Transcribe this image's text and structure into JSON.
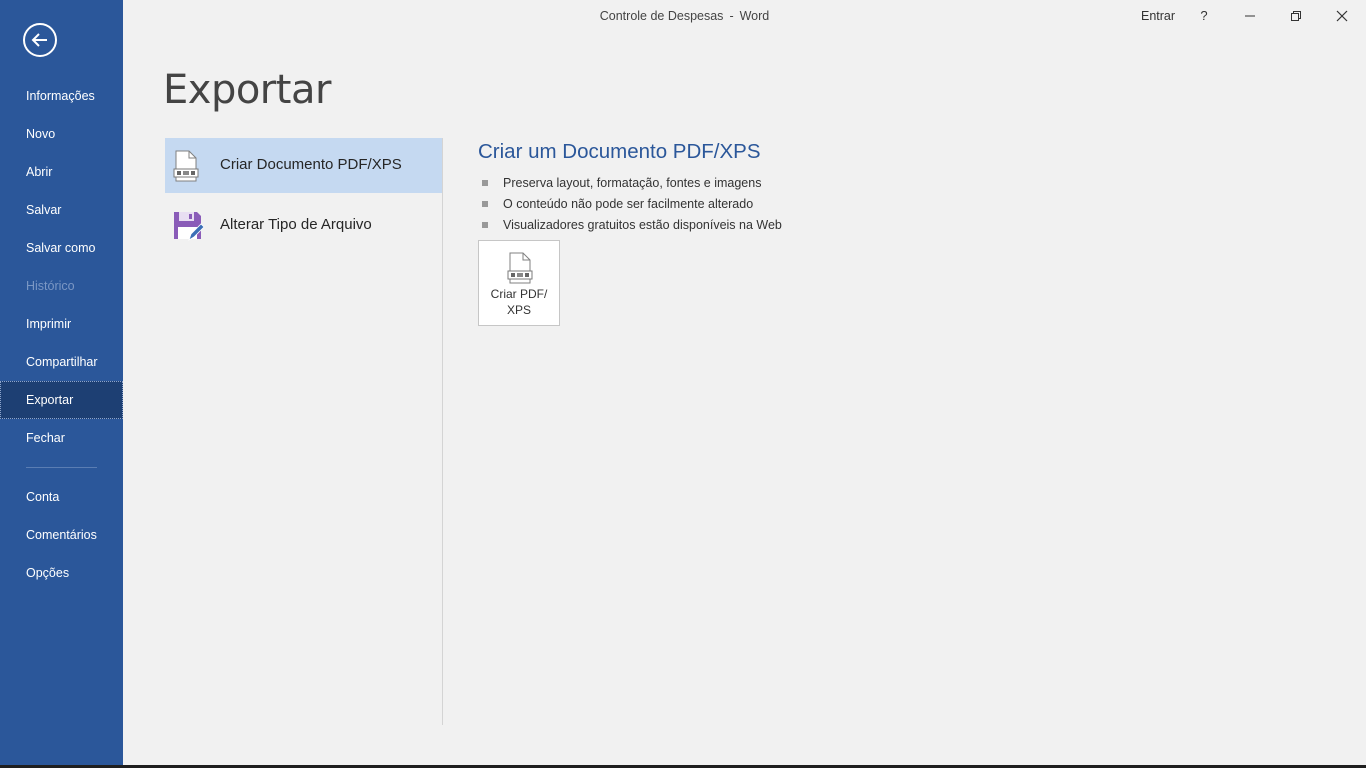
{
  "window": {
    "doc_name": "Controle de Despesas",
    "separator": "-",
    "app_name": "Word",
    "signin_label": "Entrar",
    "help_label": "?"
  },
  "sidebar": {
    "back_icon": "back-arrow-icon",
    "items": [
      {
        "label": "Informações",
        "state": "normal"
      },
      {
        "label": "Novo",
        "state": "normal"
      },
      {
        "label": "Abrir",
        "state": "normal"
      },
      {
        "label": "Salvar",
        "state": "normal"
      },
      {
        "label": "Salvar como",
        "state": "normal"
      },
      {
        "label": "Histórico",
        "state": "disabled"
      },
      {
        "label": "Imprimir",
        "state": "normal"
      },
      {
        "label": "Compartilhar",
        "state": "normal"
      },
      {
        "label": "Exportar",
        "state": "active"
      },
      {
        "label": "Fechar",
        "state": "normal"
      }
    ],
    "bottom_items": [
      {
        "label": "Conta"
      },
      {
        "label": "Comentários"
      },
      {
        "label": "Opções"
      }
    ]
  },
  "main": {
    "title": "Exportar",
    "options": [
      {
        "label": "Criar Documento PDF/XPS",
        "icon": "pdf-document-icon",
        "selected": true
      },
      {
        "label": "Alterar Tipo de Arquivo",
        "icon": "save-as-floppy-icon",
        "selected": false
      }
    ],
    "detail": {
      "title": "Criar um Documento PDF/XPS",
      "bullets": [
        "Preserva layout, formatação, fontes e imagens",
        "O conteúdo não pode ser facilmente alterado",
        "Visualizadores gratuitos estão disponíveis na Web"
      ],
      "button_label": "Criar PDF/\nXPS",
      "button_icon": "pdf-document-icon"
    }
  },
  "colors": {
    "sidebar_bg": "#2b579a",
    "sidebar_active": "#1d3f73",
    "accent_title": "#2b579a",
    "selected_option": "#c5d9f1",
    "background": "#f1f1f1",
    "floppy_purple": "#8a5cb8"
  }
}
